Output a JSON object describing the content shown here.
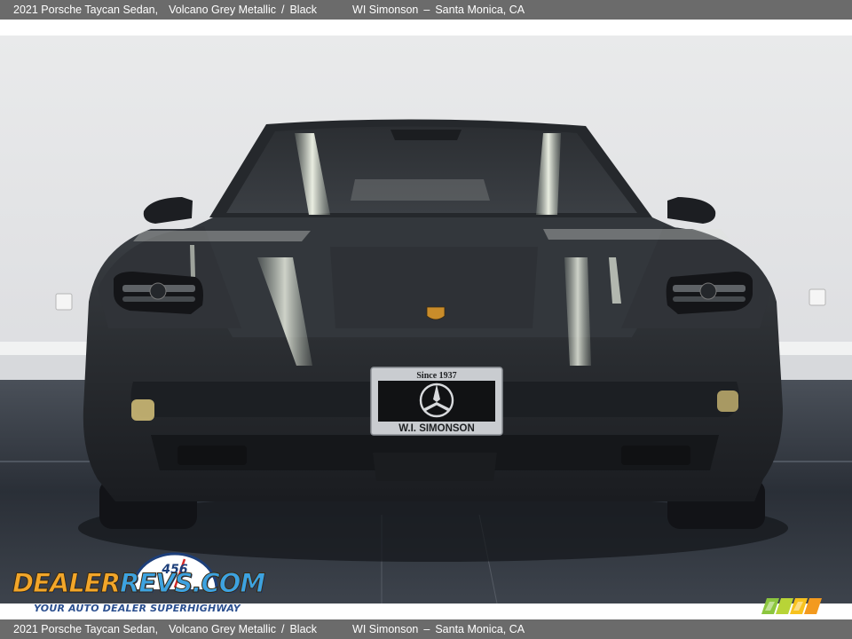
{
  "caption": {
    "vehicle": "2021 Porsche Taycan Sedan,",
    "color": "Volcano Grey Metallic",
    "divider": "/",
    "interior": "Black",
    "dealer": "WI Simonson",
    "dash": "–",
    "location": "Santa Monica, CA"
  },
  "plate": {
    "top_text": "Since 1937",
    "bottom_text": "W.I. SIMONSON"
  },
  "watermark": {
    "brand_left": "DEALER",
    "brand_right": "REVS.COM",
    "tagline": "YOUR AUTO DEALER SUPERHIGHWAY",
    "gauge_digits": "456"
  },
  "colors": {
    "caption_bar": "#6b6b6b",
    "car_body": "#2c2f33",
    "wall": "#e6e7e8",
    "floor": "#2b3038",
    "logo_orange": "#f2a62a",
    "logo_blue": "#3da2e0",
    "stripe_green": "#8cc63f",
    "stripe_yellow": "#f7c21e",
    "stripe_orange": "#f39a1e"
  }
}
